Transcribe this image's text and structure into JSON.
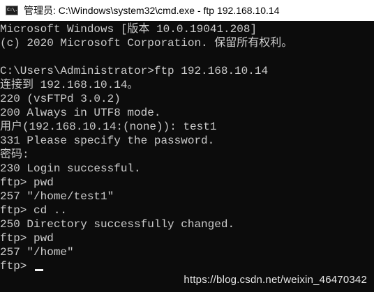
{
  "window": {
    "title": "管理员: C:\\Windows\\system32\\cmd.exe - ftp  192.168.10.14",
    "icon": "cmd-icon",
    "icon_text": "C:\\."
  },
  "console": {
    "lines": [
      "Microsoft Windows [版本 10.0.19041.208]",
      "(c) 2020 Microsoft Corporation. 保留所有权利。",
      "",
      "C:\\Users\\Administrator>ftp 192.168.10.14",
      "连接到 192.168.10.14。",
      "220 (vsFTPd 3.0.2)",
      "200 Always in UTF8 mode.",
      "用户(192.168.10.14:(none)): test1",
      "331 Please specify the password.",
      "密码:",
      "230 Login successful.",
      "ftp> pwd",
      "257 \"/home/test1\"",
      "ftp> cd ..",
      "250 Directory successfully changed.",
      "ftp> pwd",
      "257 \"/home\""
    ],
    "prompt": "ftp> "
  },
  "watermark": "https://blog.csdn.net/weixin_46470342",
  "colors": {
    "background": "#0c0c0c",
    "text": "#cccccc",
    "titlebar": "#ffffff"
  }
}
